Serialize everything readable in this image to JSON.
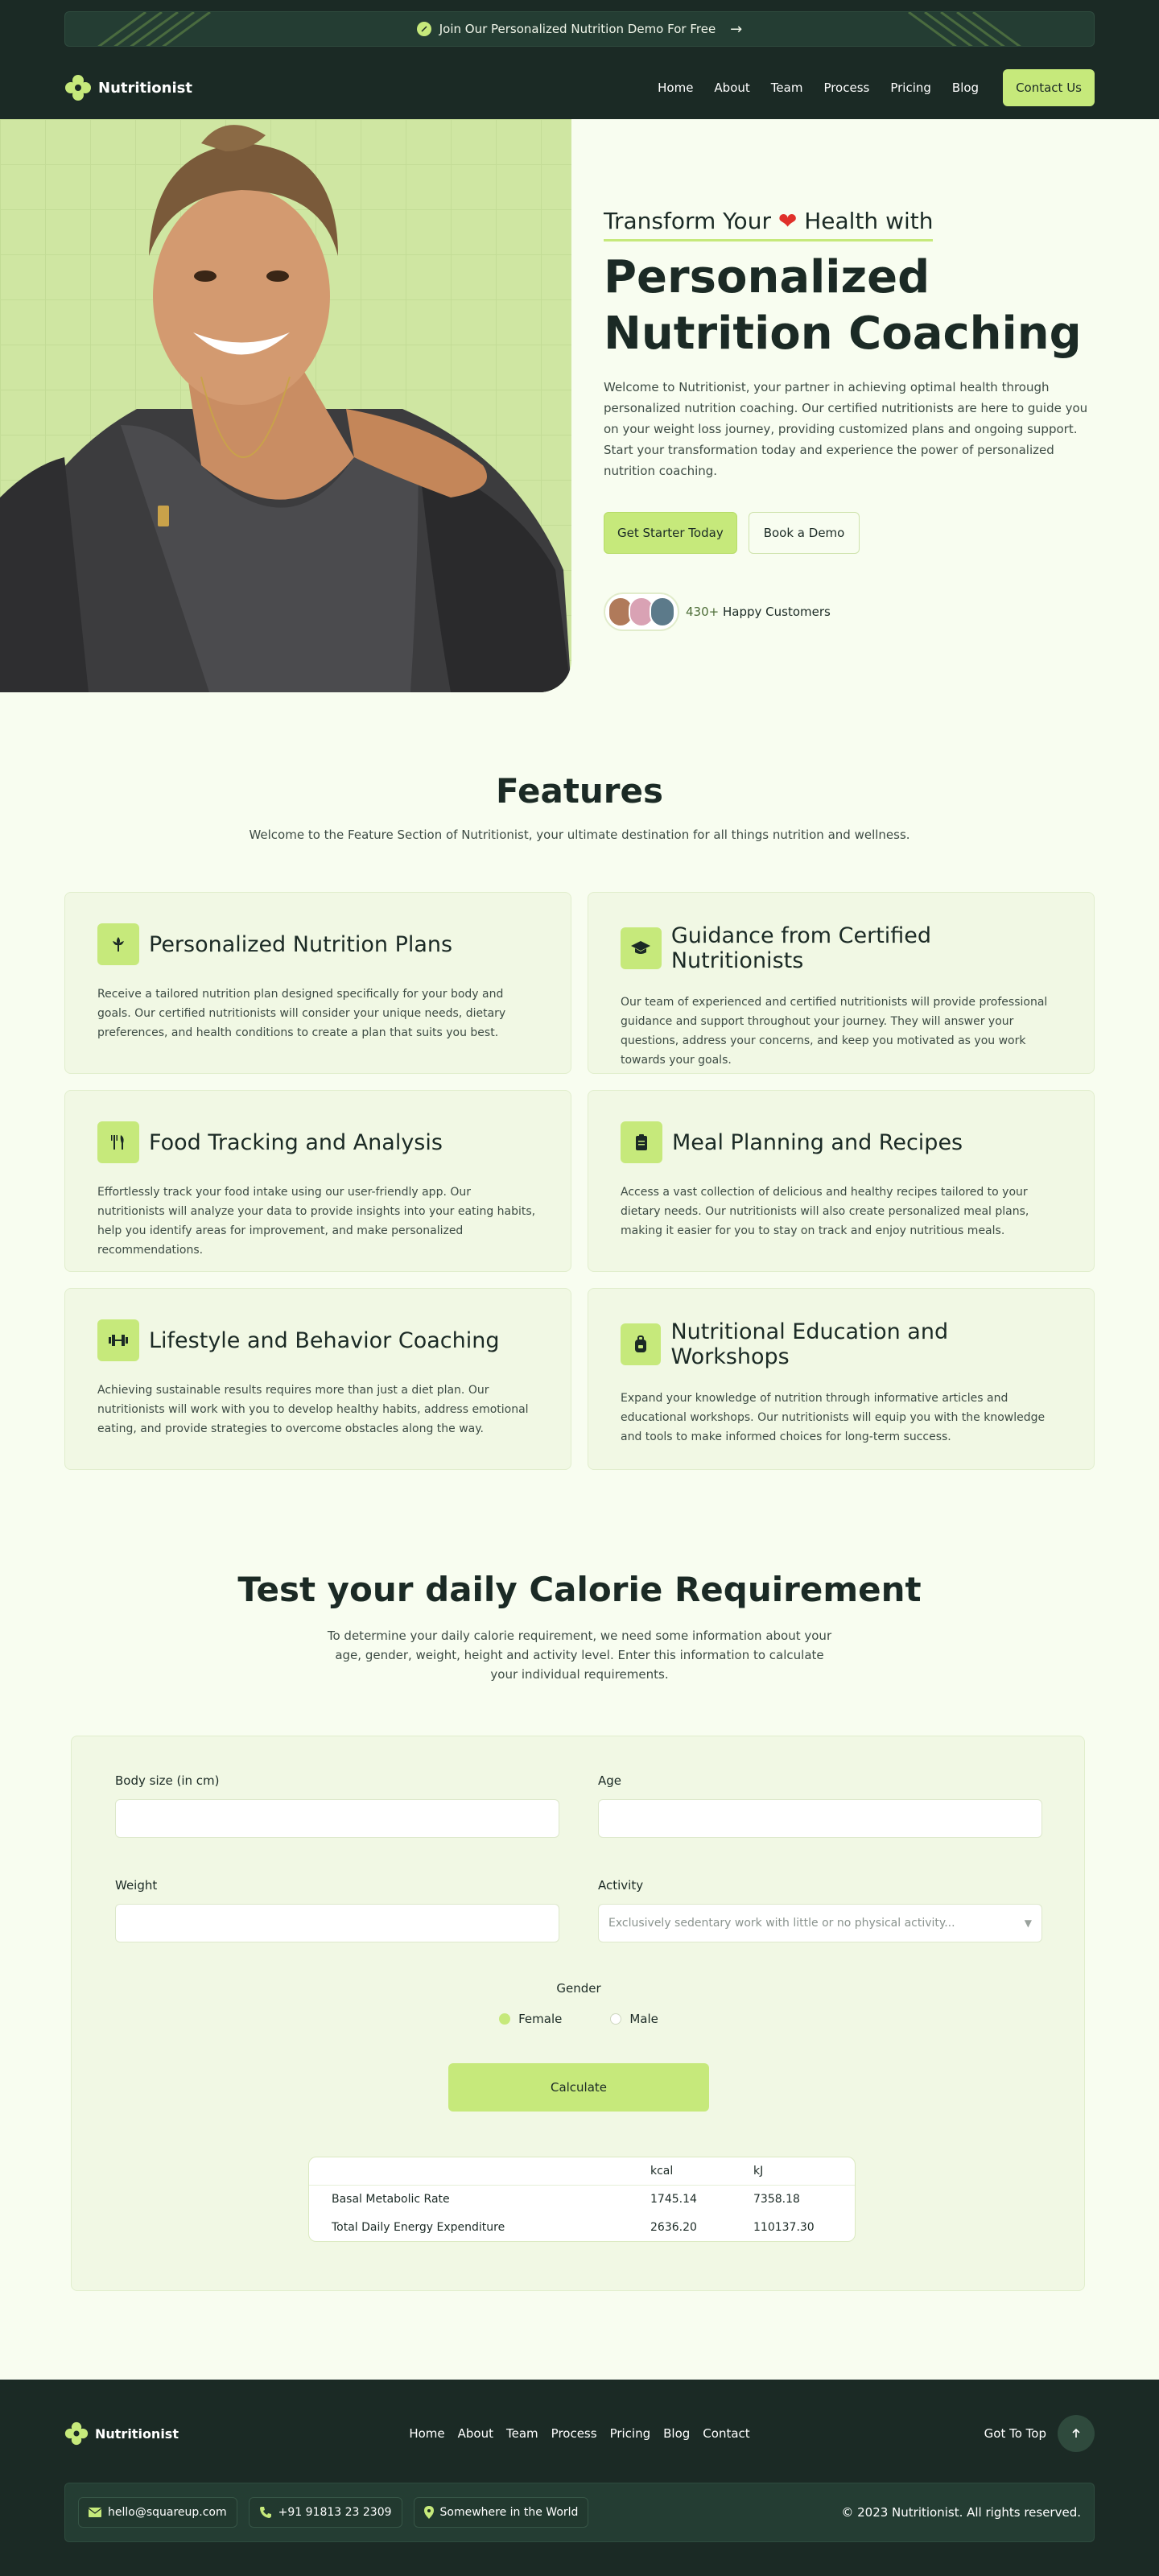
{
  "promo": {
    "text": "Join Our Personalized Nutrition Demo For Free"
  },
  "brand": {
    "name": "Nutritionist"
  },
  "nav": {
    "items": [
      "Home",
      "About",
      "Team",
      "Process",
      "Pricing",
      "Blog"
    ],
    "cta": "Contact Us"
  },
  "hero": {
    "kicker_pre": "Transform Your",
    "kicker_post": "Health with",
    "title": "Personalized Nutrition Coaching",
    "description": "Welcome to Nutritionist, your partner in achieving optimal health through personalized nutrition coaching. Our certified nutritionists are here to guide you on your weight loss journey, providing customized plans and ongoing support. Start your transformation today and experience the power of personalized nutrition coaching.",
    "primary_button": "Get Starter Today",
    "secondary_button": "Book a Demo",
    "customers_count": "430+",
    "customers_label": "Happy Customers"
  },
  "features": {
    "title": "Features",
    "subtitle": "Welcome to the Feature Section of Nutritionist, your ultimate destination for all things nutrition and wellness.",
    "cards": [
      {
        "icon": "flower-icon",
        "title": "Personalized Nutrition Plans",
        "desc": "Receive a tailored nutrition plan designed specifically for your body and goals. Our certified nutritionists will consider your unique needs, dietary preferences, and health conditions to create a plan that suits you best."
      },
      {
        "icon": "graduation-cap-icon",
        "title": "Guidance from Certified Nutritionists",
        "desc": "Our team of experienced and certified nutritionists will provide professional guidance and support throughout your journey. They will answer your questions, address your concerns, and keep you motivated as you work towards your goals."
      },
      {
        "icon": "fork-knife-icon",
        "title": "Food Tracking and Analysis",
        "desc": "Effortlessly track your food intake using our user-friendly app. Our nutritionists will analyze your data to provide insights into your eating habits, help you identify areas for improvement, and make personalized recommendations."
      },
      {
        "icon": "clipboard-icon",
        "title": "Meal Planning and Recipes",
        "desc": "Access a vast collection of delicious and healthy recipes tailored to your dietary needs. Our nutritionists will also create personalized meal plans, making it easier for you to stay on track and enjoy nutritious meals."
      },
      {
        "icon": "dumbbell-icon",
        "title": "Lifestyle and Behavior Coaching",
        "desc": "Achieving sustainable results requires more than just a diet plan. Our nutritionists will work with you to develop healthy habits, address emotional eating, and provide strategies to overcome obstacles along the way."
      },
      {
        "icon": "backpack-icon",
        "title": "Nutritional Education and Workshops",
        "desc": "Expand your knowledge of nutrition through informative articles and educational workshops. Our nutritionists will equip you with the knowledge and tools to make informed choices for long-term success."
      }
    ]
  },
  "calorie": {
    "title": "Test your daily Calorie Requirement",
    "subtitle": "To determine your daily calorie requirement, we need some information about your age, gender, weight, height and activity level. Enter this information to calculate your individual requirements.",
    "body_size_label": "Body size (in cm)",
    "age_label": "Age",
    "weight_label": "Weight",
    "activity_label": "Activity",
    "activity_value": "Exclusively sedentary work with little or no physical activity...",
    "gender_label": "Gender",
    "female_label": "Female",
    "male_label": "Male",
    "calculate_button": "Calculate",
    "table": {
      "headers": [
        "",
        "kcal",
        "kJ"
      ],
      "rows": [
        [
          "Basal Metabolic Rate",
          "1745.14",
          "7358.18"
        ],
        [
          "Total Daily Energy Expenditure",
          "2636.20",
          "110137.30"
        ]
      ]
    }
  },
  "footer": {
    "brand": "Nutritionist",
    "nav": [
      "Home",
      "About",
      "Team",
      "Process",
      "Pricing",
      "Blog",
      "Contact"
    ],
    "go_top": "Got To Top",
    "email": "hello@squareup.com",
    "phone": "+91 91813 23 2309",
    "location": "Somewhere in the World",
    "copyright": "© 2023 Nutritionist. All rights reserved."
  },
  "colors": {
    "accent": "#c6e97b",
    "dark": "#1b2a25",
    "background": "#f8fdf0"
  }
}
